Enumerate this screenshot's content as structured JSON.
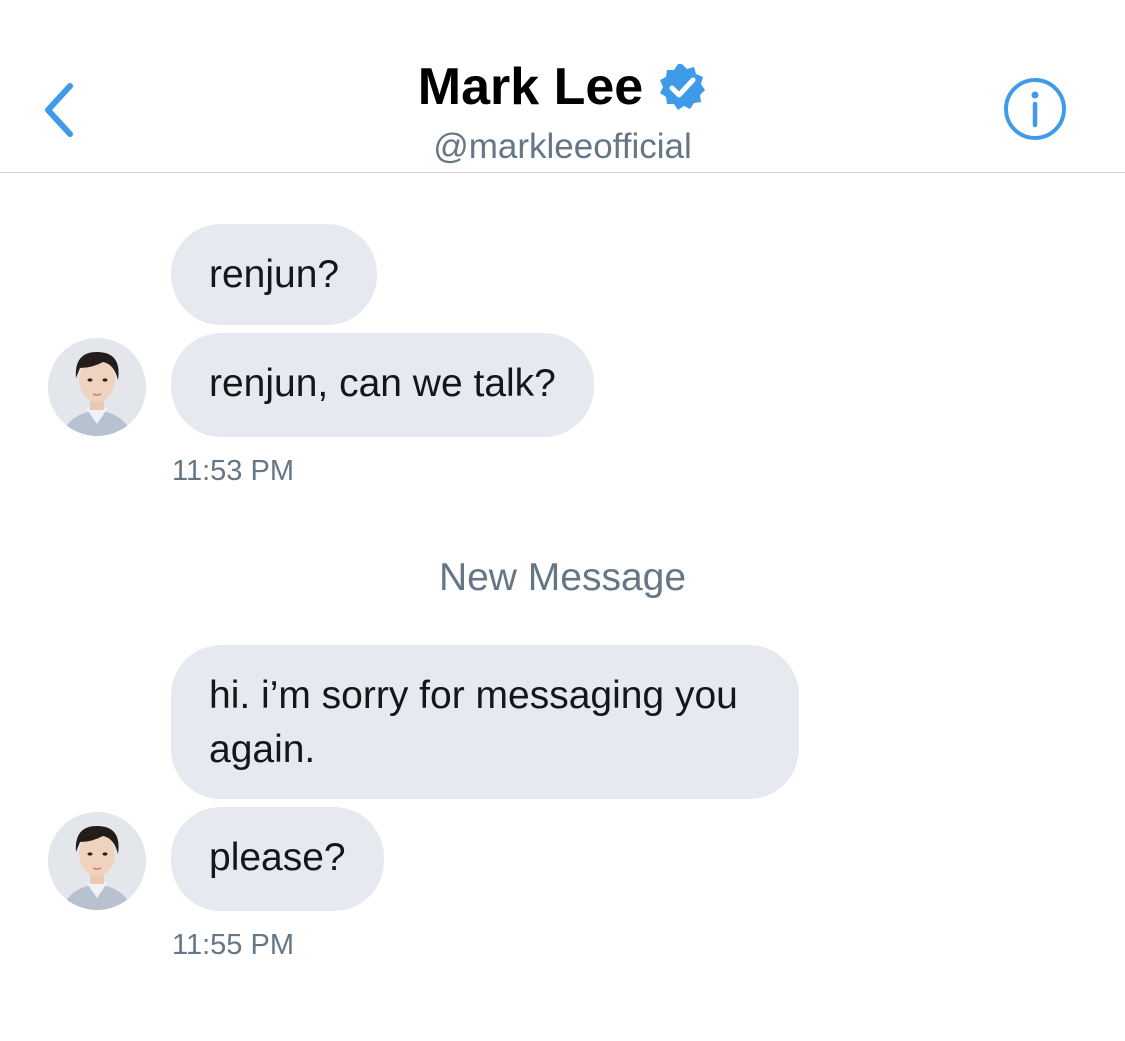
{
  "header": {
    "name": "Mark Lee",
    "handle": "@markleeofficial",
    "verified": true,
    "accent_color": "#3e9be9",
    "back_icon": "chevron-left-icon",
    "info_icon": "info-icon"
  },
  "groups": [
    {
      "messages": [
        "renjun?",
        "renjun, can we talk?"
      ],
      "time": "11:53 PM"
    },
    {
      "messages": [
        "hi. i’m sorry for messaging you again.",
        "please?"
      ],
      "time": "11:55 PM"
    }
  ],
  "divider": {
    "label": "New Message"
  },
  "colors": {
    "bubble_bg": "#e6e9ef",
    "secondary_text": "#657786",
    "accent": "#3e9be9"
  }
}
